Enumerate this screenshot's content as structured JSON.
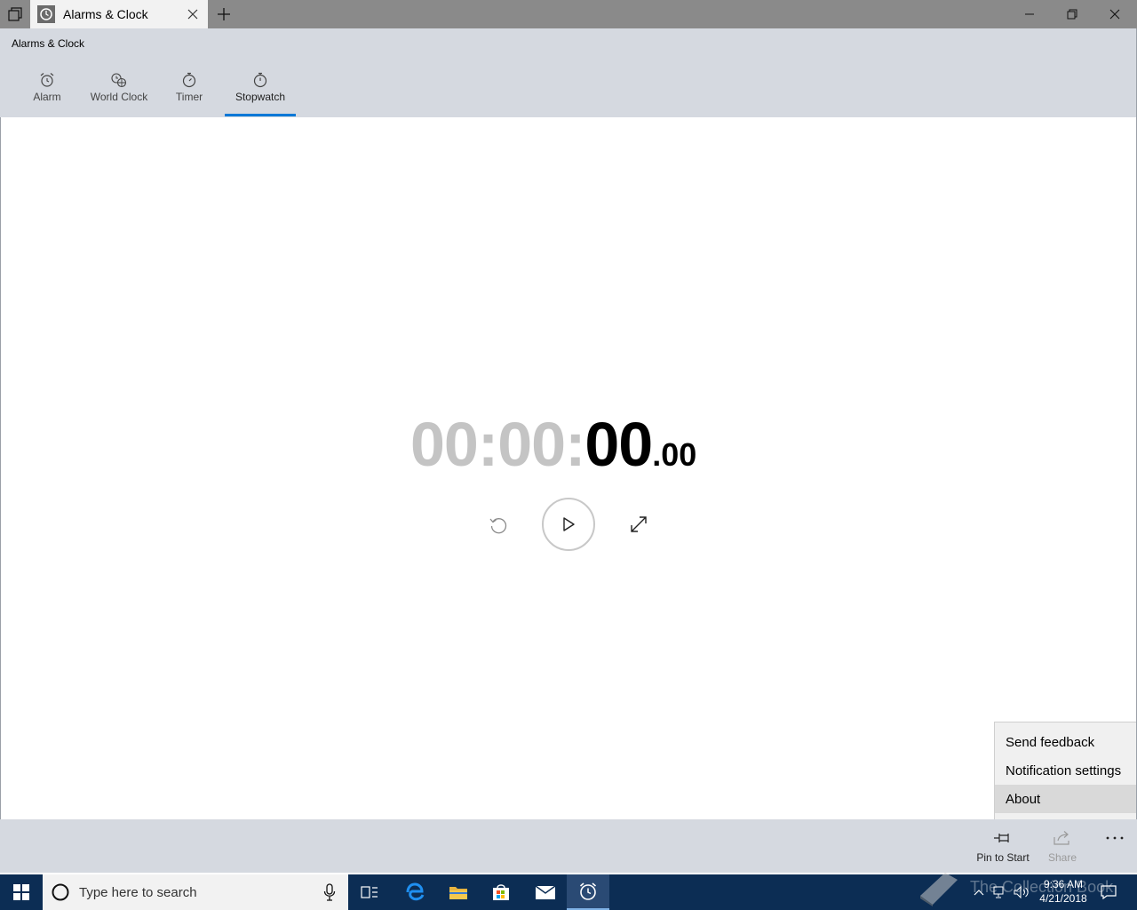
{
  "window": {
    "tab_title": "Alarms & Clock",
    "app_title": "Alarms & Clock"
  },
  "nav": {
    "tabs": [
      {
        "label": "Alarm",
        "icon": "alarm-clock-icon"
      },
      {
        "label": "World Clock",
        "icon": "globe-clock-icon"
      },
      {
        "label": "Timer",
        "icon": "timer-icon"
      },
      {
        "label": "Stopwatch",
        "icon": "stopwatch-icon",
        "active": true
      }
    ]
  },
  "stopwatch": {
    "hours": "00",
    "sep1": ":",
    "minutes": "00",
    "sep2": ":",
    "seconds": "00",
    "fraction": ".00"
  },
  "menu": {
    "items": [
      "Send feedback",
      "Notification settings",
      "About"
    ]
  },
  "commandbar": {
    "pin_label": "Pin to Start",
    "share_label": "Share"
  },
  "taskbar": {
    "search_placeholder": "Type here to search",
    "time": "9:36 AM",
    "date": "4/21/2018"
  },
  "watermark": "The Collection Book",
  "colors": {
    "accent": "#0078d7",
    "taskbar": "#0c2d54",
    "header": "#d5d9e0"
  }
}
